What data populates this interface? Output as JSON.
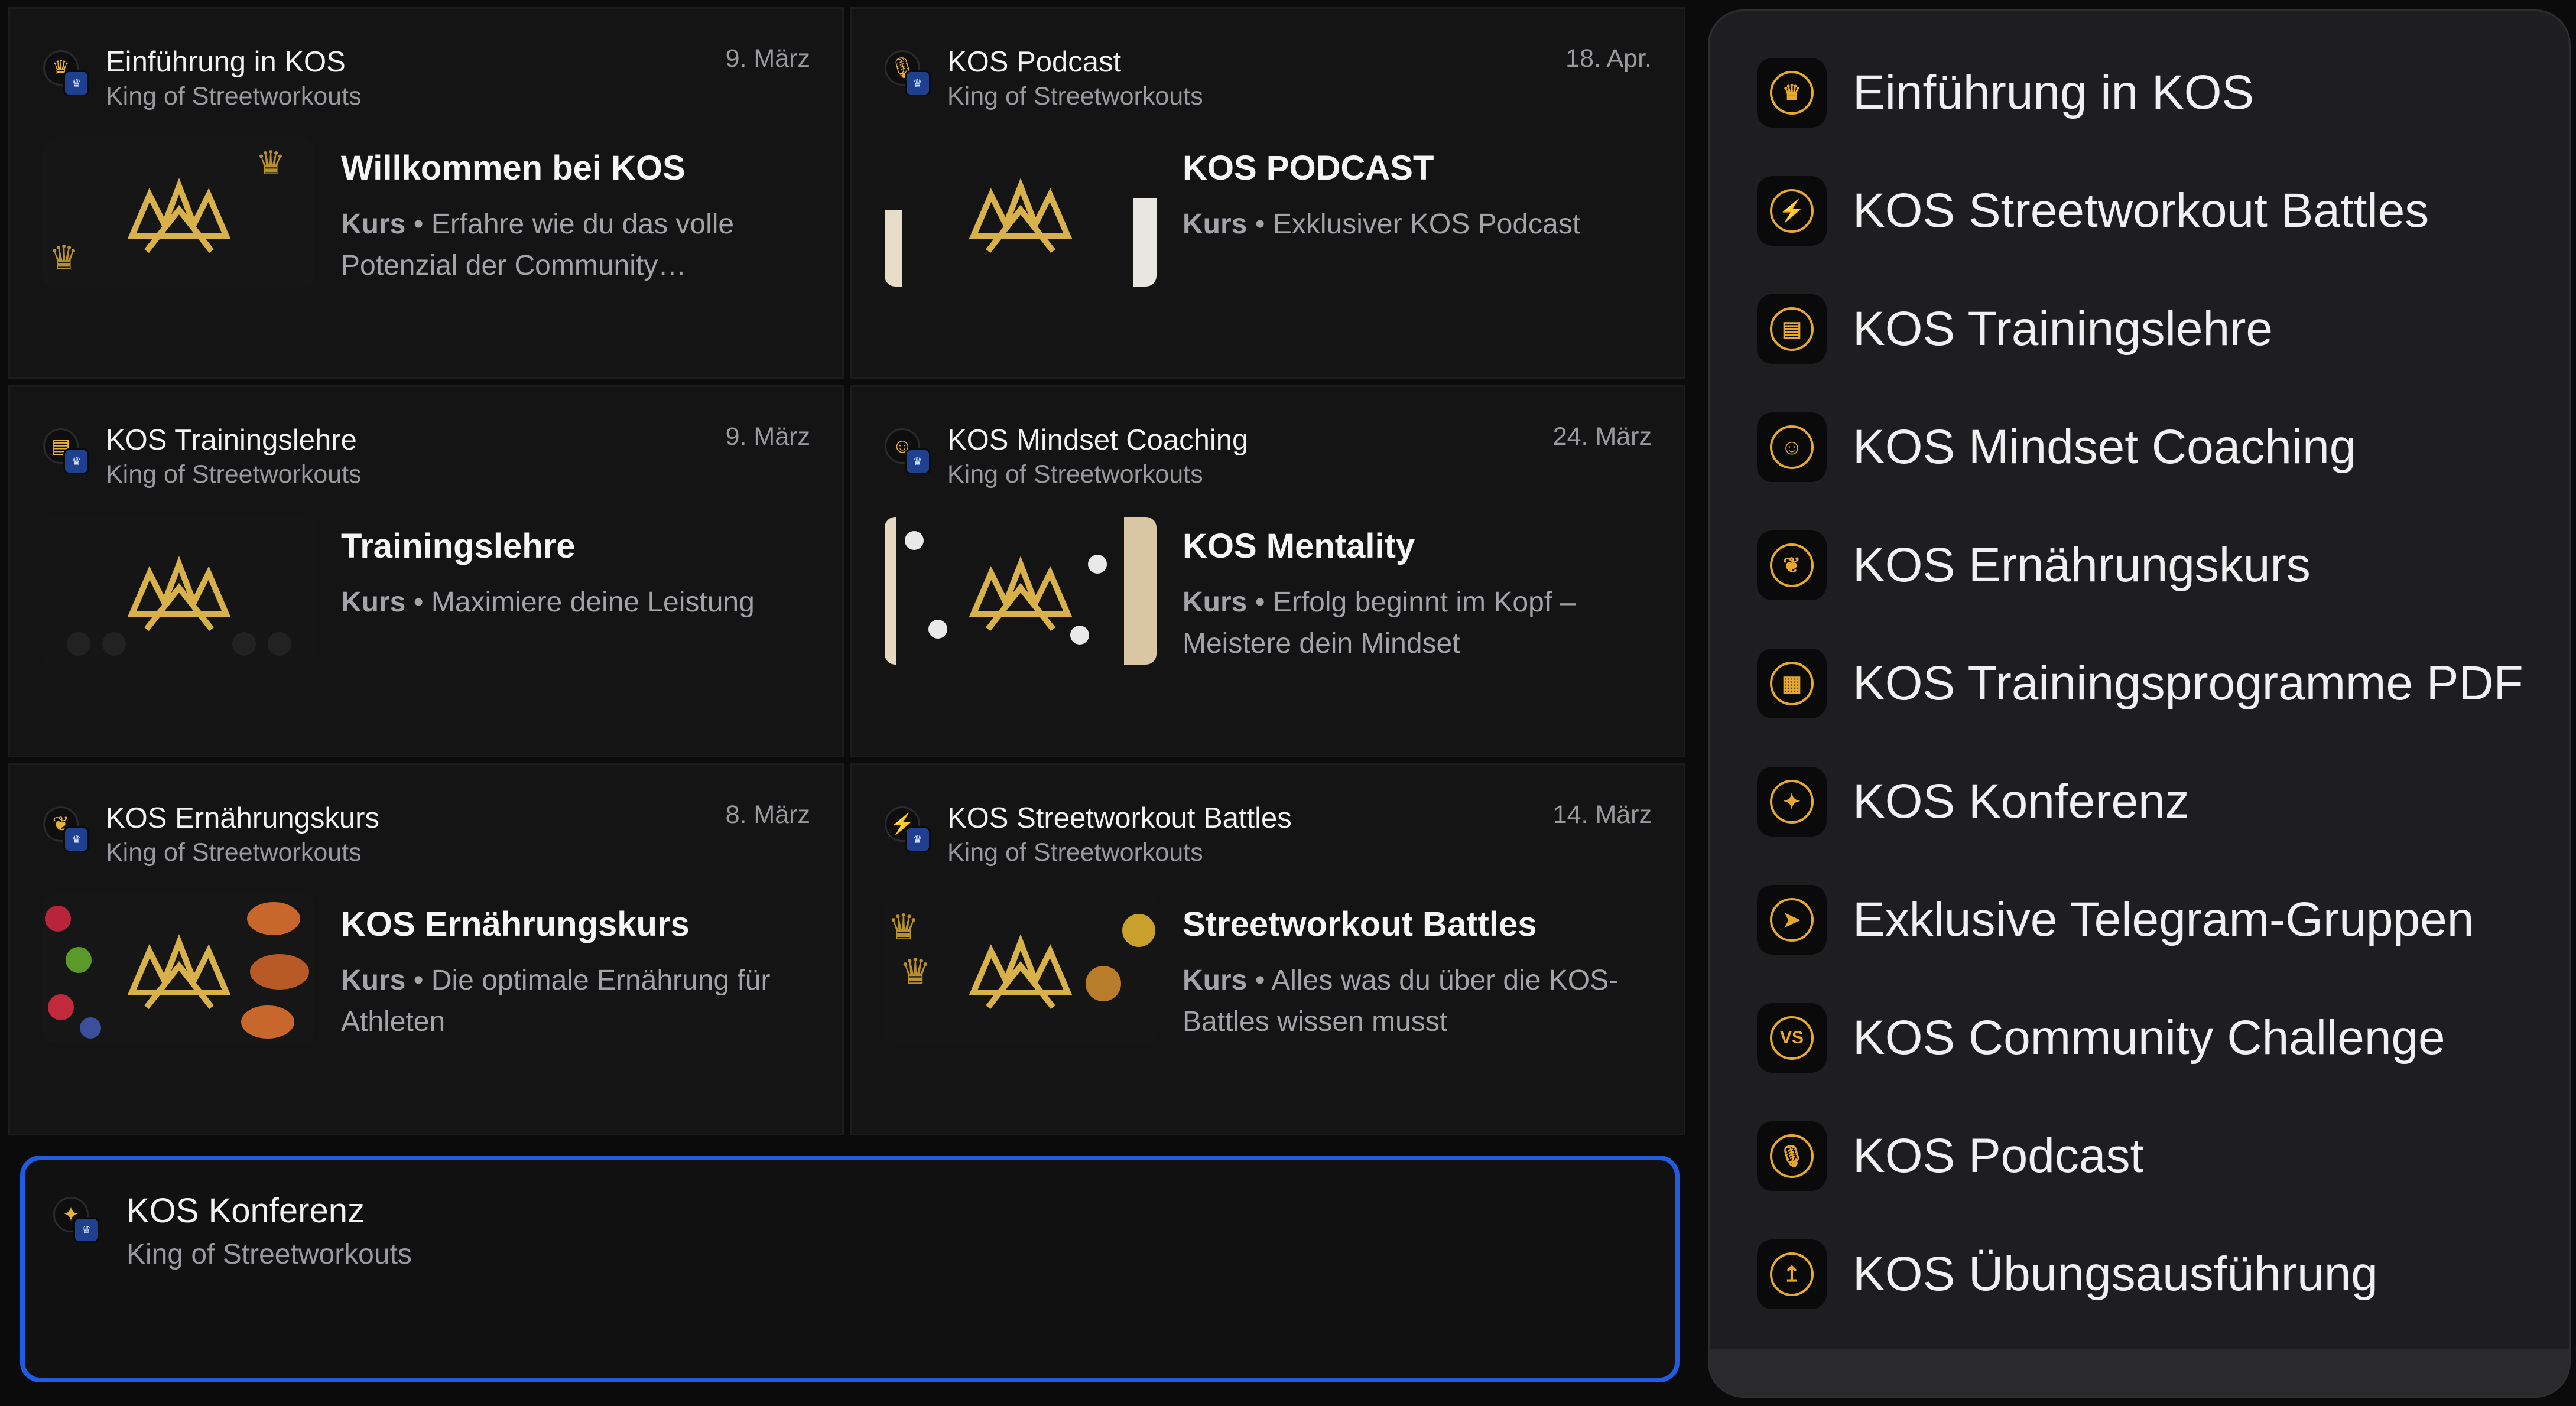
{
  "cards": [
    {
      "title": "Einführung in KOS",
      "sub": "King of Streetworkouts",
      "date": "9. März",
      "post_title": "Willkommen bei KOS",
      "desc_kind": "Kurs",
      "desc_sep": " • ",
      "desc": "Erfahre wie du das volle Potenzial der Community…",
      "icon": "crown-icon"
    },
    {
      "title": "KOS Podcast",
      "sub": "King of Streetworkouts",
      "date": "18. Apr.",
      "post_title": "KOS PODCAST",
      "desc_kind": "Kurs",
      "desc_sep": " • ",
      "desc": "Exklusiver KOS Podcast",
      "icon": "microphone-icon"
    },
    {
      "title": "KOS Trainingslehre",
      "sub": "King of Streetworkouts",
      "date": "9. März",
      "post_title": "Trainingslehre",
      "desc_kind": "Kurs",
      "desc_sep": " • ",
      "desc": "Maximiere deine Leistung",
      "icon": "training-plan-icon"
    },
    {
      "title": "KOS Mindset Coaching",
      "sub": "King of Streetworkouts",
      "date": "24. März",
      "post_title": "KOS Mentality",
      "desc_kind": "Kurs",
      "desc_sep": " • ",
      "desc": "Erfolg beginnt im Kopf – Meistere dein Mindset",
      "icon": "brain-icon"
    },
    {
      "title": "KOS Ernährungskurs",
      "sub": "King of Streetworkouts",
      "date": "8. März",
      "post_title": "KOS Ernährungskurs",
      "desc_kind": "Kurs",
      "desc_sep": " • ",
      "desc": "Die optimale Ernährung für Athleten",
      "icon": "leaf-icon"
    },
    {
      "title": "KOS Streetworkout Battles",
      "sub": "King of Streetworkouts",
      "date": "14. März",
      "post_title": "Streetworkout Battles",
      "desc_kind": "Kurs",
      "desc_sep": " • ",
      "desc": "Alles was du über die KOS-Battles wissen musst",
      "icon": "lightning-icon"
    }
  ],
  "selected": {
    "title": "KOS Konferenz",
    "sub": "King of Streetworkouts",
    "icon": "conference-icon"
  },
  "menu": [
    {
      "label": "Einführung in KOS",
      "glyph": "♛",
      "icon": "crown-icon"
    },
    {
      "label": "KOS Streetworkout Battles",
      "glyph": "⚡",
      "icon": "lightning-icon"
    },
    {
      "label": "KOS Trainingslehre",
      "glyph": "▤",
      "icon": "training-plan-icon"
    },
    {
      "label": "KOS Mindset Coaching",
      "glyph": "☺",
      "icon": "brain-icon"
    },
    {
      "label": "KOS Ernährungskurs",
      "glyph": "❦",
      "icon": "leaf-icon"
    },
    {
      "label": "KOS Trainingsprogramme PDF",
      "glyph": "▦",
      "icon": "document-icon"
    },
    {
      "label": "KOS Konferenz",
      "glyph": "✦",
      "icon": "conference-icon"
    },
    {
      "label": "Exklusive Telegram-Gruppen",
      "glyph": "➤",
      "icon": "telegram-icon"
    },
    {
      "label": "KOS Community Challenge",
      "glyph": "VS",
      "icon": "versus-icon"
    },
    {
      "label": "KOS Podcast",
      "glyph": "🎙",
      "icon": "microphone-icon"
    },
    {
      "label": "KOS Übungsausführung",
      "glyph": "↥",
      "icon": "exercise-icon"
    }
  ],
  "colors": {
    "accent": "#e6a92e",
    "selection": "#1f5ce0",
    "background": "#0b0b0c",
    "card": "#141415"
  }
}
